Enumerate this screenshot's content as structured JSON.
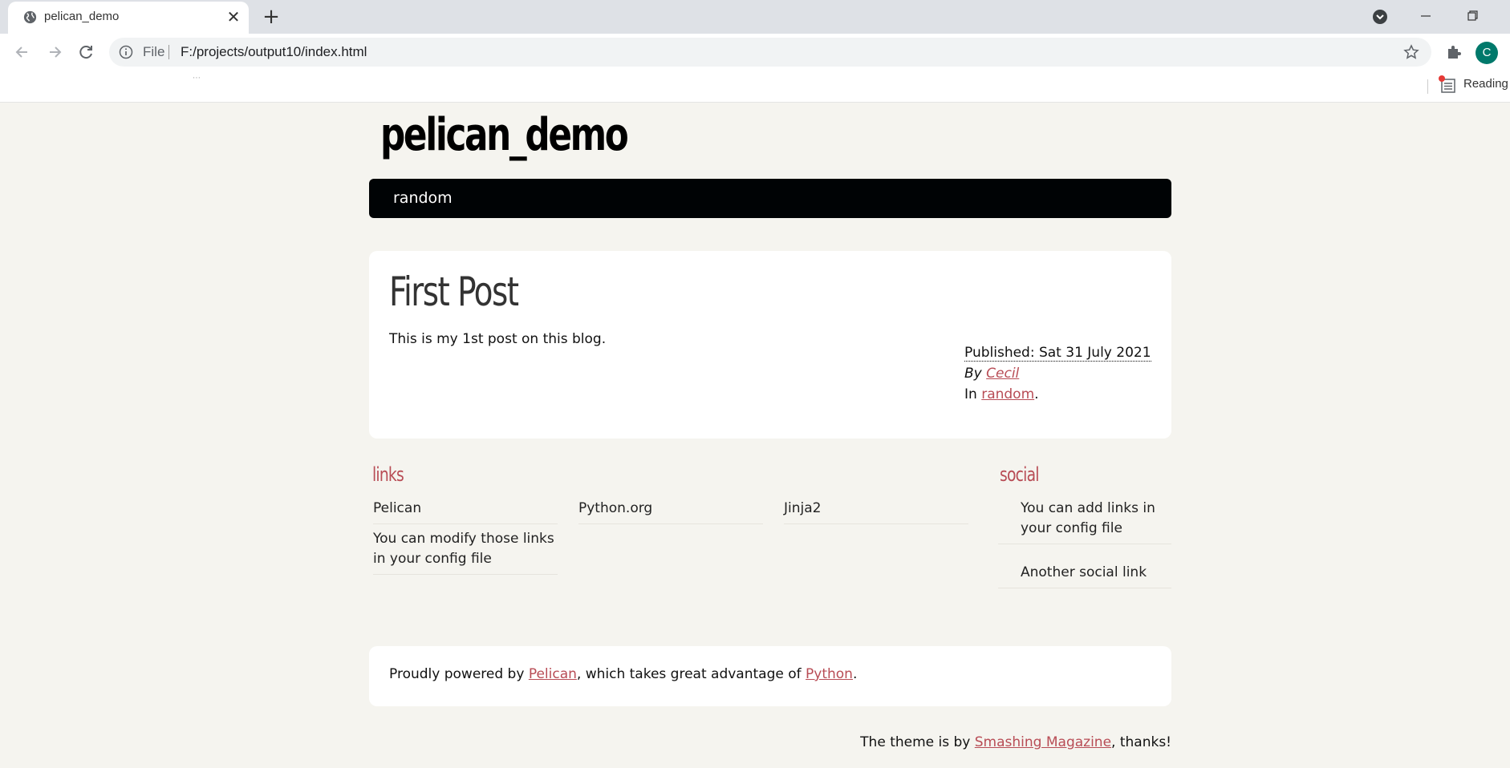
{
  "browser": {
    "tab_title": "pelican_demo",
    "tab_close": "✕",
    "new_tab": "+",
    "omnibox_scheme": "File",
    "url": "F:/projects/output10/index.html",
    "avatar_letter": "C",
    "reading_list": "Reading",
    "bookmark_dots": "⋯",
    "accent_avatar": "#00796b"
  },
  "site": {
    "title": "pelican_demo",
    "menu": [
      "random"
    ]
  },
  "post": {
    "title": "First Post",
    "body": "This is my 1st post on this blog.",
    "published_label": "Published: Sat 31 July 2021",
    "by_prefix": "By ",
    "author": "Cecil",
    "in_prefix": "In ",
    "category": "random",
    "period": "."
  },
  "blogroll": {
    "heading": "links",
    "items": [
      "Pelican",
      "Python.org",
      "Jinja2",
      "You can modify those links in your config file"
    ]
  },
  "social": {
    "heading": "social",
    "items": [
      "You can add links in your config file",
      "Another social link"
    ]
  },
  "footer": {
    "prefix": "Proudly powered by ",
    "pelican": "Pelican",
    "middle": ", which takes great advantage of ",
    "python": "Python",
    "suffix": "."
  },
  "credit": {
    "prefix": "The theme is by ",
    "link": "Smashing Magazine",
    "suffix": ", thanks!"
  },
  "colors": {
    "link": "#b84c55",
    "menubar": "#000305",
    "page_bg": "#f5f4ef"
  }
}
